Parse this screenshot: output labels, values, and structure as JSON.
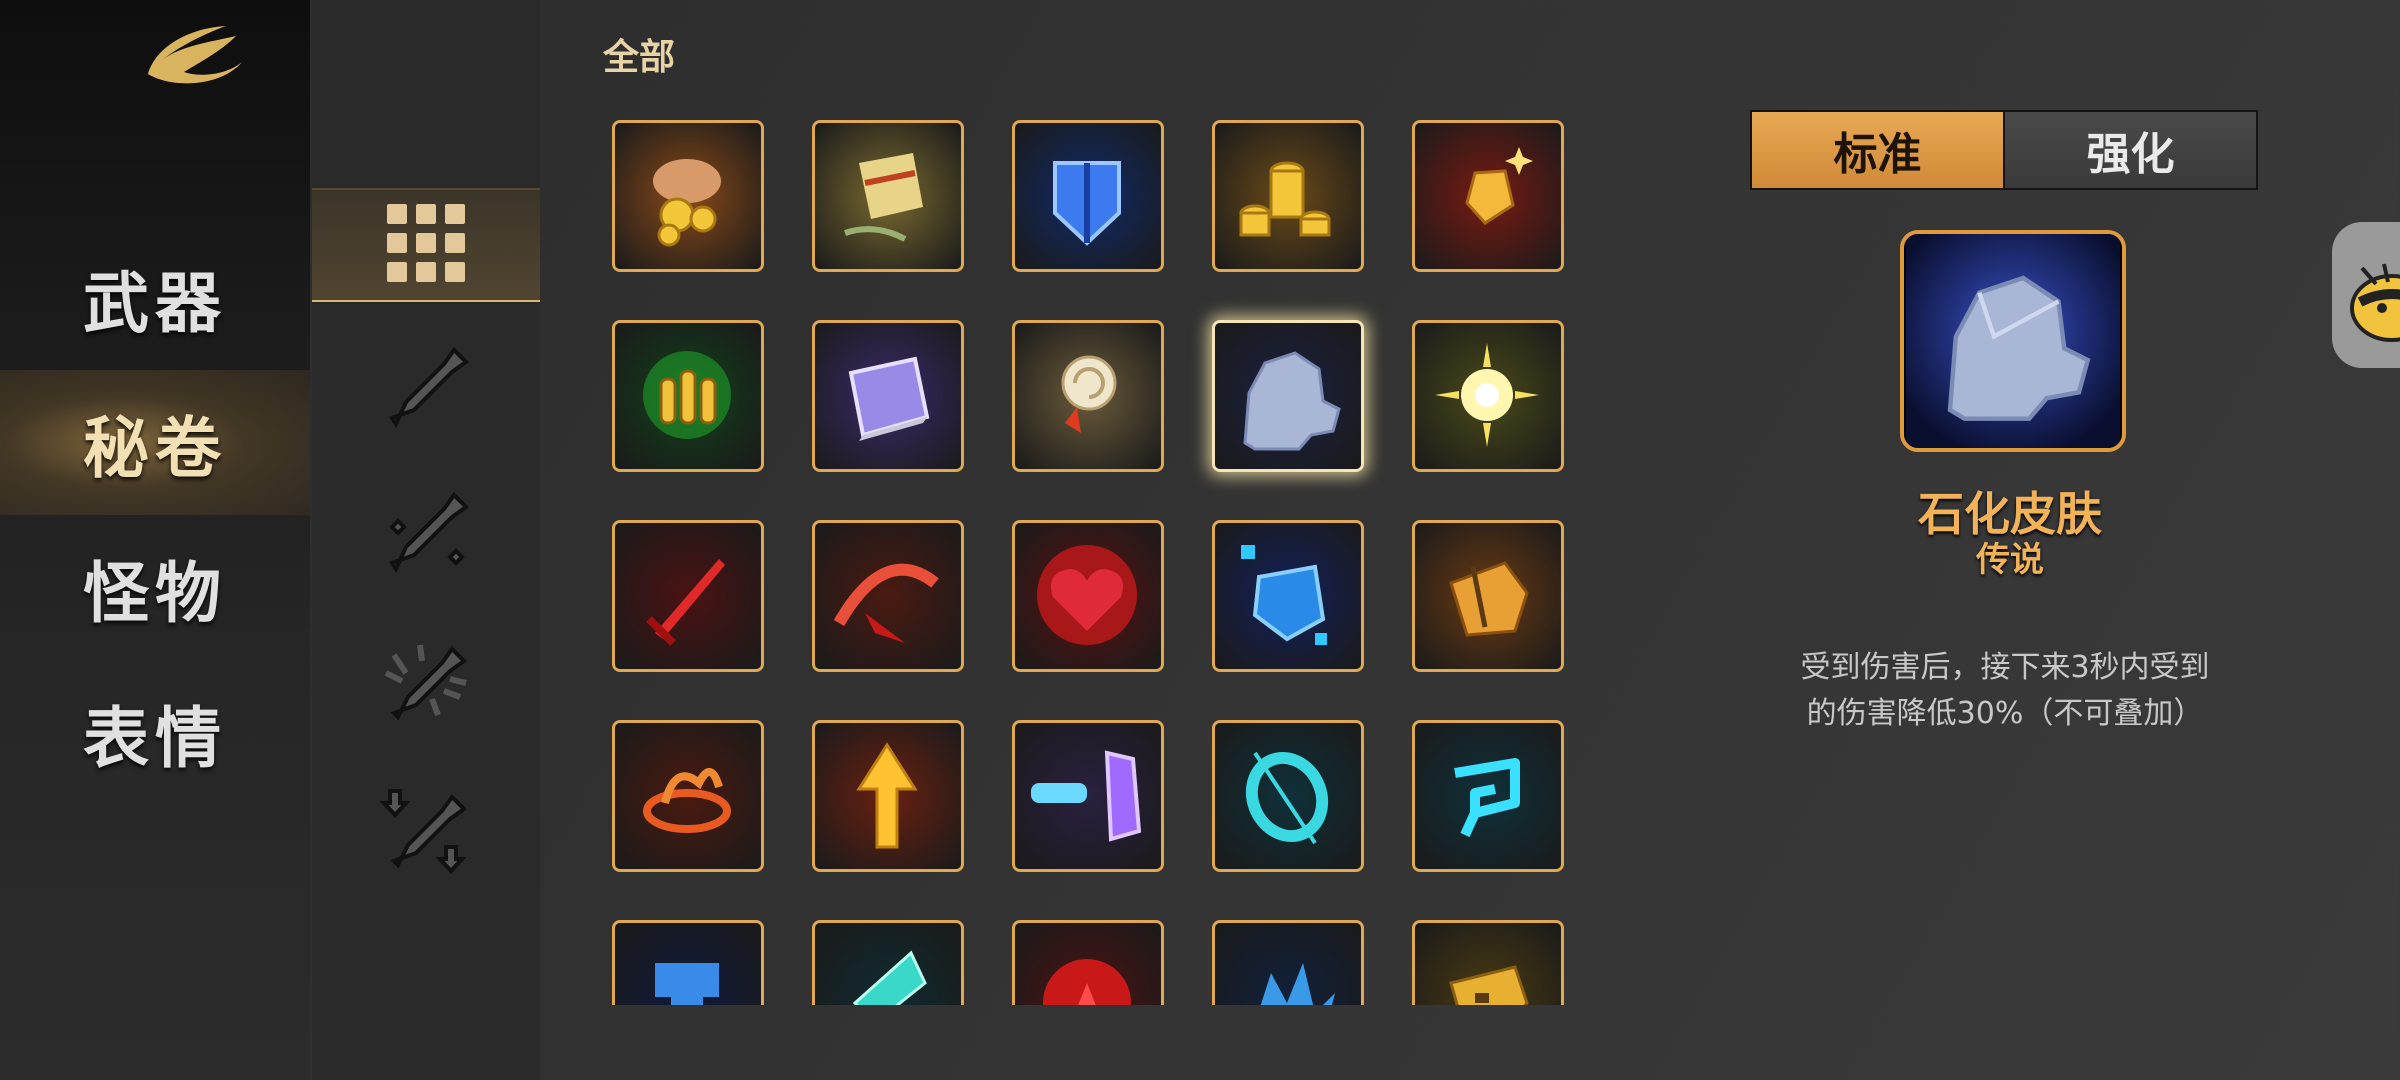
{
  "nav": {
    "logo": "game-logo-icon",
    "items": [
      {
        "label": "武器",
        "active": false
      },
      {
        "label": "秘卷",
        "active": true
      },
      {
        "label": "怪物",
        "active": false
      },
      {
        "label": "表情",
        "active": false
      }
    ]
  },
  "subnav": {
    "items": [
      {
        "icon": "grid-all-icon",
        "active": true
      },
      {
        "icon": "stick-icon",
        "active": false
      },
      {
        "icon": "stick-sparkle-icon",
        "active": false
      },
      {
        "icon": "stick-burst-icon",
        "active": false
      },
      {
        "icon": "stick-arrows-down-icon",
        "active": false
      }
    ]
  },
  "section": {
    "title": "全部"
  },
  "grid": {
    "items": [
      {
        "icon": "coin-hand-icon",
        "bg": "#8a4a18"
      },
      {
        "icon": "scroll-bone-icon",
        "bg": "#7a6a30"
      },
      {
        "icon": "blue-shield-icon",
        "bg": "#102a6a"
      },
      {
        "icon": "coin-stack-icon",
        "bg": "#6a4a18"
      },
      {
        "icon": "gold-crystal-icon",
        "bg": "#7a1a12"
      },
      {
        "icon": "green-bullets-icon",
        "bg": "#12401a"
      },
      {
        "icon": "spell-book-icon",
        "bg": "#3a2a6a"
      },
      {
        "icon": "spiral-staff-icon",
        "bg": "#6a5a3a"
      },
      {
        "icon": "stone-skin-icon",
        "bg": "#1a2040",
        "selected": true
      },
      {
        "icon": "light-burst-icon",
        "bg": "#4a4a1a"
      },
      {
        "icon": "red-sword-icon",
        "bg": "#4a1212"
      },
      {
        "icon": "red-slash-icon",
        "bg": "#4a1a12"
      },
      {
        "icon": "red-heart-icon",
        "bg": "#5a1212"
      },
      {
        "icon": "blue-gem-icon",
        "bg": "#12205a"
      },
      {
        "icon": "gold-glove-icon",
        "bg": "#6a3a12"
      },
      {
        "icon": "fire-loop-icon",
        "bg": "#4a1a10"
      },
      {
        "icon": "gold-arrow-up-icon",
        "bg": "#6a2010"
      },
      {
        "icon": "purple-portal-icon",
        "bg": "#2a2040"
      },
      {
        "icon": "cyan-ring-icon",
        "bg": "#10303a"
      },
      {
        "icon": "cyan-rune-icon",
        "bg": "#10303a"
      },
      {
        "icon": "blue-helmet-icon",
        "bg": "#101a3a"
      },
      {
        "icon": "cyan-blade-icon",
        "bg": "#102a30"
      },
      {
        "icon": "red-orb-icon",
        "bg": "#4a1212"
      },
      {
        "icon": "blue-splash-icon",
        "bg": "#10203a"
      },
      {
        "icon": "gold-mask-icon",
        "bg": "#4a3a12"
      }
    ]
  },
  "tabs": {
    "standard": "标准",
    "enhanced": "强化"
  },
  "detail": {
    "icon": "stone-skin-icon",
    "name": "石化皮肤",
    "rarity": "传说",
    "desc_line1": "受到伤害后，接下来3秒内受到",
    "desc_line2": "的伤害降低30%（不可叠加）"
  },
  "side": {
    "icon": "bee-avatar-icon"
  },
  "colors": {
    "accent": "#e0a851",
    "title": "#f2b258"
  }
}
